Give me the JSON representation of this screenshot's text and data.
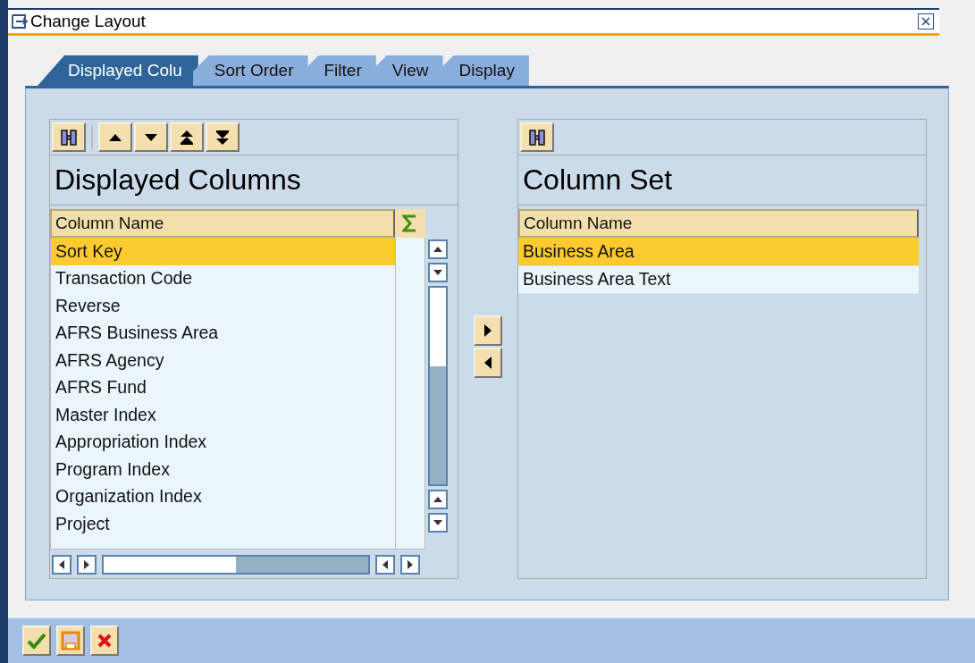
{
  "window": {
    "title": "Change Layout"
  },
  "tabs": [
    {
      "label": "Displayed Colu",
      "selected": true
    },
    {
      "label": "Sort Order",
      "selected": false
    },
    {
      "label": "Filter",
      "selected": false
    },
    {
      "label": "View",
      "selected": false
    },
    {
      "label": "Display",
      "selected": false
    }
  ],
  "displayed_columns": {
    "title": "Displayed Columns",
    "column_header": "Column Name",
    "rows": [
      {
        "label": "Sort Key",
        "selected": true
      },
      {
        "label": "Transaction Code",
        "selected": false
      },
      {
        "label": "Reverse",
        "selected": false
      },
      {
        "label": "AFRS Business Area",
        "selected": false
      },
      {
        "label": "AFRS Agency",
        "selected": false
      },
      {
        "label": "AFRS Fund",
        "selected": false
      },
      {
        "label": "Master Index",
        "selected": false
      },
      {
        "label": "Appropriation Index",
        "selected": false
      },
      {
        "label": "Program Index",
        "selected": false
      },
      {
        "label": "Organization Index",
        "selected": false
      },
      {
        "label": "Project",
        "selected": false
      }
    ]
  },
  "column_set": {
    "title": "Column Set",
    "column_header": "Column Name",
    "rows": [
      {
        "label": "Business Area",
        "selected": true
      },
      {
        "label": "Business Area Text",
        "selected": false
      }
    ]
  }
}
